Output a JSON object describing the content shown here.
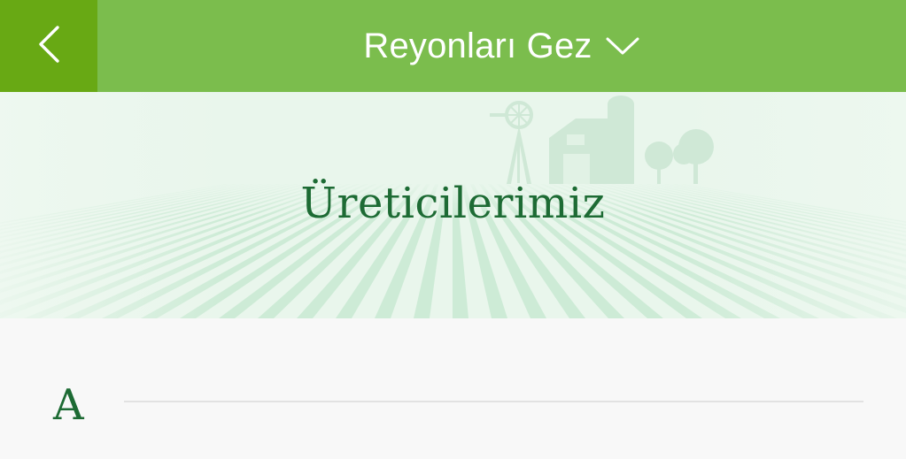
{
  "header": {
    "back_icon": "chevron-left-icon",
    "title": "Reyonları Gez",
    "dropdown_icon": "chevron-down-icon"
  },
  "banner": {
    "title": "Üreticilerimiz",
    "illustration": "farm-landscape"
  },
  "sections": [
    {
      "letter": "A"
    }
  ],
  "colors": {
    "header_bg": "#7bbd4d",
    "back_bg": "#68a914",
    "banner_bg": "#e9f6ec",
    "title_green": "#1d6b34"
  }
}
